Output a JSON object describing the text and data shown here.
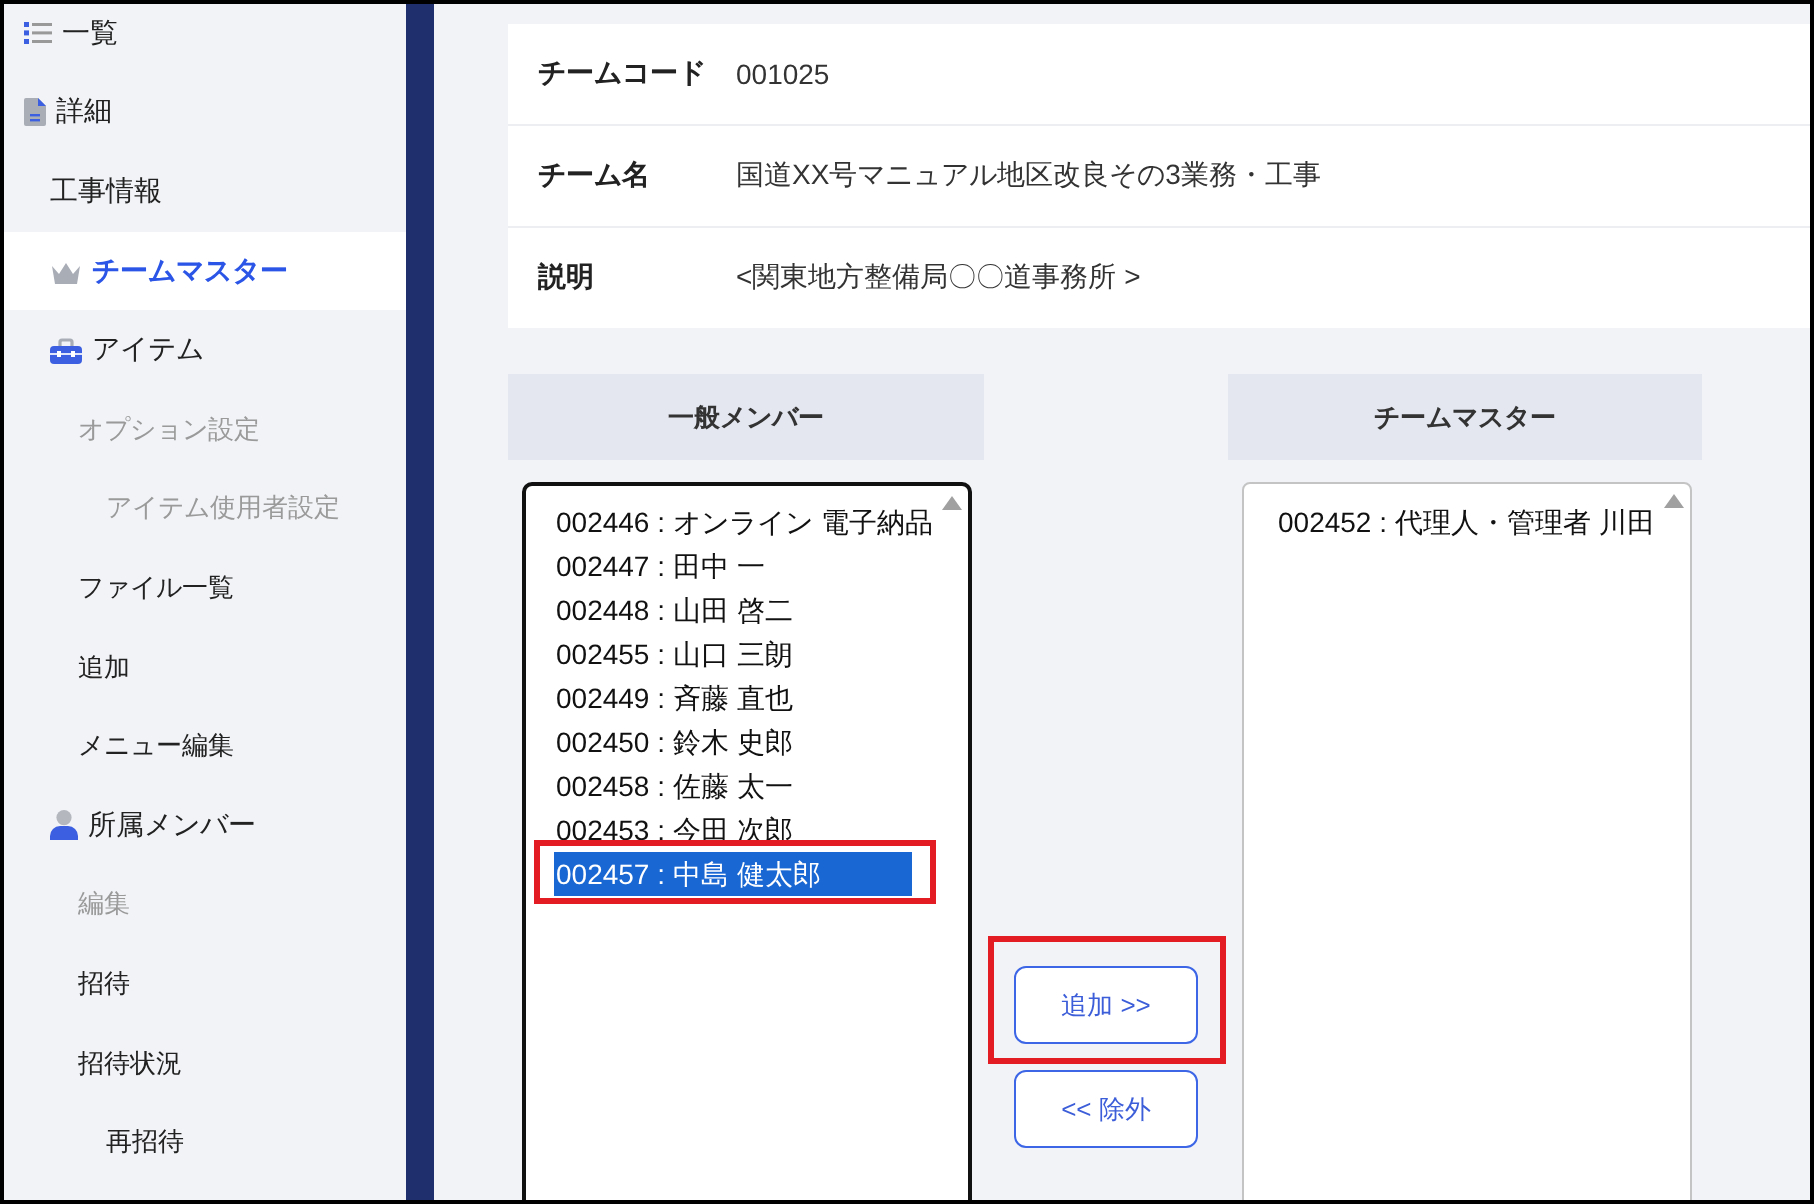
{
  "sidebar": {
    "items": [
      {
        "label": "一覧",
        "selected": false,
        "disabled": false
      },
      {
        "label": "詳細",
        "selected": false,
        "disabled": false,
        "children": [
          {
            "label": "工事情報",
            "selected": false,
            "disabled": false
          },
          {
            "label": "チームマスター",
            "selected": true,
            "disabled": false
          },
          {
            "label": "アイテム",
            "selected": false,
            "disabled": false,
            "children": [
              {
                "label": "オプション設定",
                "selected": false,
                "disabled": true,
                "children": [
                  {
                    "label": "アイテム使用者設定",
                    "selected": false,
                    "disabled": true
                  }
                ]
              },
              {
                "label": "ファイル一覧",
                "selected": false,
                "disabled": false
              },
              {
                "label": "追加",
                "selected": false,
                "disabled": false
              },
              {
                "label": "メニュー編集",
                "selected": false,
                "disabled": false
              }
            ]
          },
          {
            "label": "所属メンバー",
            "selected": false,
            "disabled": false,
            "children": [
              {
                "label": "編集",
                "selected": false,
                "disabled": true
              },
              {
                "label": "招待",
                "selected": false,
                "disabled": false
              },
              {
                "label": "招待状況",
                "selected": false,
                "disabled": false,
                "children": [
                  {
                    "label": "再招待",
                    "selected": false,
                    "disabled": false
                  }
                ]
              }
            ]
          }
        ]
      }
    ]
  },
  "team_info": {
    "rows": [
      {
        "label": "チームコード",
        "value": "001025"
      },
      {
        "label": "チーム名",
        "value": "国道XX号マニュアル地区改良その3業務・工事"
      },
      {
        "label": "説明",
        "value": "<関東地方整備局〇〇道事務所 >"
      }
    ]
  },
  "general_members": {
    "title": "一般メンバー",
    "items": [
      {
        "text": "002446 : オンライン 電子納品",
        "selected": false,
        "highlighted": false
      },
      {
        "text": "002447 : 田中 一",
        "selected": false,
        "highlighted": false
      },
      {
        "text": "002448 : 山田 啓二",
        "selected": false,
        "highlighted": false
      },
      {
        "text": "002455 : 山口 三朗",
        "selected": false,
        "highlighted": false
      },
      {
        "text": "002449 : 斉藤 直也",
        "selected": false,
        "highlighted": false
      },
      {
        "text": "002450 : 鈴木 史郎",
        "selected": false,
        "highlighted": false
      },
      {
        "text": "002458 : 佐藤 太一",
        "selected": false,
        "highlighted": false
      },
      {
        "text": "002453 : 今田 次郎",
        "selected": false,
        "highlighted": false
      },
      {
        "text": "002457 : 中島 健太郎",
        "selected": true,
        "highlighted": true
      }
    ]
  },
  "actions": [
    {
      "label": "追加 >>",
      "highlighted": true
    },
    {
      "label": "<< 除外",
      "highlighted": false
    }
  ],
  "team_masters": {
    "title": "チームマスター",
    "items": [
      {
        "text": "002452 : 代理人・管理者 川田",
        "selected": false,
        "highlighted": false
      }
    ]
  }
}
